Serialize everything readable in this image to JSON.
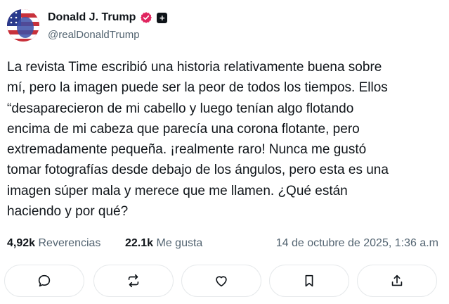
{
  "author": {
    "name": "Donald J. Trump",
    "handle": "@realDonaldTrump",
    "plus_badge": "+"
  },
  "post": {
    "text": "La revista Time escribió una historia relativamente buena sobre\nmí, pero la imagen puede ser la peor de todos los tiempos. Ellos\n“desaparecieron de mi cabello y luego tenían algo flotando\nencima de mi cabeza que parecía una corona flotante, pero\nextremadamente pequeña. ¡realmente raro! Nunca me gustó\ntomar fotografías desde debajo de los ángulos, pero esta es una\nimagen súper mala y merece que me llamen. ¿Qué están\nhaciendo y por qué?"
  },
  "stats": {
    "reposts_count": "4,92k",
    "reposts_label": "Reverencias",
    "likes_count": "22.1k",
    "likes_label": "Me gusta",
    "timestamp": "14 de octubre de 2025, 1:36 a.m"
  },
  "actions": [
    "reply-icon",
    "repost-icon",
    "like-icon",
    "bookmark-icon",
    "share-icon"
  ],
  "colors": {
    "verified_badge": "#e0245e",
    "text_primary": "#0f1419",
    "text_secondary": "#536471",
    "button_border": "#e6e9eb"
  }
}
